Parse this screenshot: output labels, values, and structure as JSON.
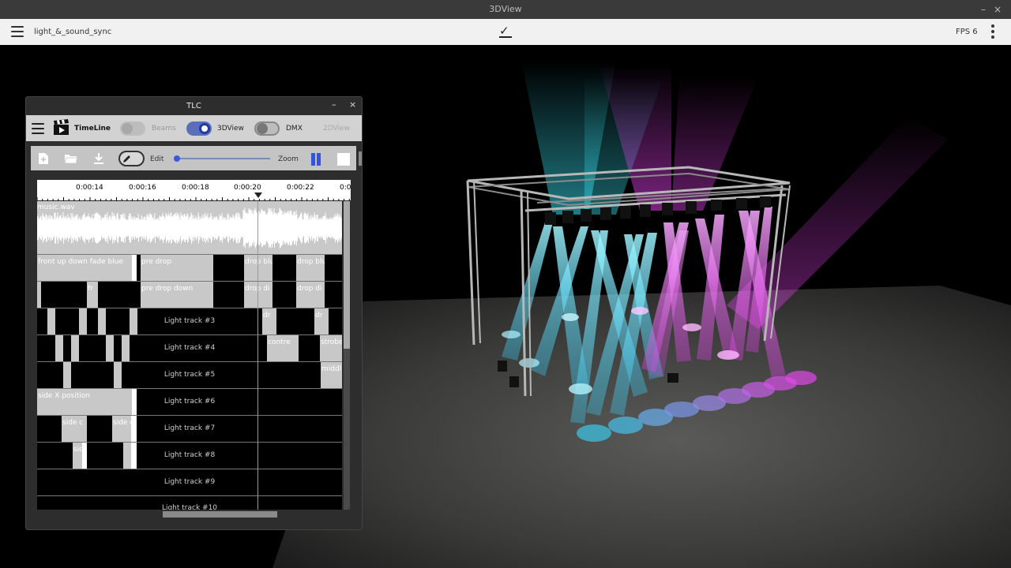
{
  "window": {
    "title": "3DView",
    "minimize": "–",
    "close": "×"
  },
  "toolbar": {
    "project_name": "light_&_sound_sync",
    "fps": "FPS 6"
  },
  "tlc": {
    "title": "TLC",
    "minimize": "–",
    "close": "×",
    "nav": {
      "timeline_label": "TimeLine",
      "toggles": [
        {
          "label": "Beams",
          "on": false,
          "enabled": false
        },
        {
          "label": "3DView",
          "on": true,
          "enabled": true
        },
        {
          "label": "DMX",
          "on": false,
          "enabled": true
        }
      ],
      "view2d_label": "2DView"
    },
    "tools": {
      "edit_label": "Edit",
      "zoom_label": "Zoom",
      "zoom_level": 0.05
    },
    "ruler": {
      "ticks": [
        "0:00:14",
        "0:00:16",
        "0:00:18",
        "0:00:20",
        "0:00:22",
        "0:0"
      ]
    },
    "audio_track": {
      "label": "music.wav"
    },
    "clips": {
      "front_up_down_fade_blue": "front up down fade blue",
      "pre_drop": "pre drop",
      "drop_blue": "drop blu",
      "drop_blue_2": "drop blu",
      "pre_drop_down": "pre drop down",
      "drop_down": "drop di",
      "drop_down_2": "drop di",
      "dr_1": "dr",
      "dr_2": "dr",
      "contre": "contre",
      "strobe": "strobe",
      "middle": "middl",
      "side_x_position": "side X position",
      "side_1": "side c",
      "side_2": "side c",
      "side_3": "sid",
      "fr": "fr"
    },
    "track_labels": [
      "Light track #3",
      "Light track #4",
      "Light track #5",
      "Light track #6",
      "Light track #7",
      "Light track #8",
      "Light track #9",
      "Light track #10"
    ]
  },
  "colors": {
    "beam_cyan": "#38e0f0",
    "beam_magenta": "#e040e8",
    "accent_blue": "#3355dd"
  }
}
